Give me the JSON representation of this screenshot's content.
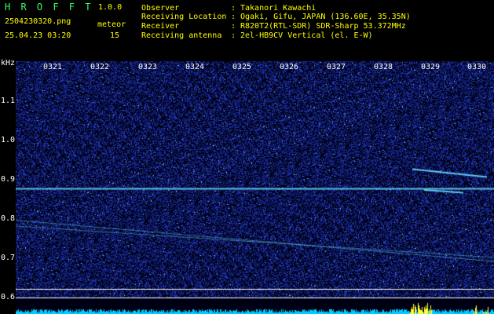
{
  "app": {
    "name": "H R O F F T",
    "version": "1.0.0"
  },
  "file": {
    "name": "2504230320.png",
    "datetime": "25.04.23 03:20"
  },
  "meteor": {
    "label": "meteor",
    "count": "15"
  },
  "info": [
    {
      "key": "Observer",
      "sep": ":",
      "value": "Takanori Kawachi"
    },
    {
      "key": "Receiving Location",
      "sep": ":",
      "value": "Ogaki, Gifu, JAPAN (136.60E, 35.35N)"
    },
    {
      "key": "Receiver",
      "sep": ":",
      "value": "R820T2(RTL-SDR) SDR-Sharp 53.372MHz"
    },
    {
      "key": "Receiving antenna",
      "sep": ":",
      "value": "2el-HB9CV Vertical (el. E-W)"
    }
  ],
  "y_axis": {
    "unit": "kHz",
    "ticks": [
      {
        "label": "1.1",
        "value": 1.1
      },
      {
        "label": "1.0",
        "value": 1.0
      },
      {
        "label": "0.9",
        "value": 0.9
      },
      {
        "label": "0.8",
        "value": 0.8
      },
      {
        "label": "0.7",
        "value": 0.7
      },
      {
        "label": "0.6",
        "value": 0.6
      }
    ]
  },
  "x_axis": {
    "ticks": [
      "0321",
      "0322",
      "0323",
      "0324",
      "0325",
      "0326",
      "0327",
      "0328",
      "0329",
      "0330"
    ]
  },
  "colors": {
    "background": "#000014",
    "noise": "#1a2aa8",
    "trace": "#66ddff",
    "bars": "#00ccff",
    "bars_hot": "#ffff33"
  }
}
